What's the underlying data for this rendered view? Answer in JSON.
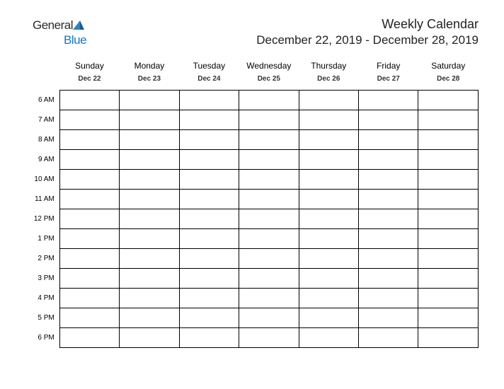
{
  "logo": {
    "text_general": "General",
    "text_blue": "Blue"
  },
  "header": {
    "title": "Weekly Calendar",
    "range": "December 22, 2019 - December 28, 2019"
  },
  "days": [
    {
      "name": "Sunday",
      "date": "Dec 22"
    },
    {
      "name": "Monday",
      "date": "Dec 23"
    },
    {
      "name": "Tuesday",
      "date": "Dec 24"
    },
    {
      "name": "Wednesday",
      "date": "Dec 25"
    },
    {
      "name": "Thursday",
      "date": "Dec 26"
    },
    {
      "name": "Friday",
      "date": "Dec 27"
    },
    {
      "name": "Saturday",
      "date": "Dec 28"
    }
  ],
  "hours": [
    "6 AM",
    "7 AM",
    "8 AM",
    "9 AM",
    "10 AM",
    "11 AM",
    "12 PM",
    "1 PM",
    "2 PM",
    "3 PM",
    "4 PM",
    "5 PM",
    "6 PM"
  ]
}
